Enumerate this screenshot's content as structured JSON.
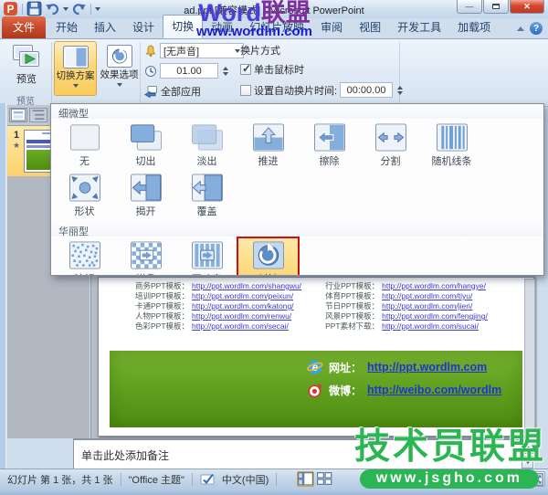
{
  "window": {
    "title": "ad.ppt [兼容模式] - Microsoft PowerPoint",
    "controls": [
      "minimize",
      "restore",
      "close"
    ]
  },
  "qat": {
    "icons": [
      "powerpoint-logo",
      "save",
      "undo",
      "redo",
      "customize-qat"
    ]
  },
  "tabs": [
    {
      "id": "file",
      "label": "文件",
      "file": true
    },
    {
      "id": "home",
      "label": "开始"
    },
    {
      "id": "insert",
      "label": "插入"
    },
    {
      "id": "design",
      "label": "设计"
    },
    {
      "id": "transitions",
      "label": "切换",
      "active": true
    },
    {
      "id": "animations",
      "label": "动画"
    },
    {
      "id": "slideshow",
      "label": "幻灯片放映"
    },
    {
      "id": "review",
      "label": "审阅"
    },
    {
      "id": "view",
      "label": "视图"
    },
    {
      "id": "developer",
      "label": "开发工具"
    },
    {
      "id": "addins",
      "label": "加载项"
    }
  ],
  "ribbon": {
    "preview_label": "预览",
    "preview_group_caption": "预览",
    "transition_scheme_label": "切换方案",
    "effect_options_label": "效果选项",
    "sound_value": "[无声音]",
    "duration_value": "01.00",
    "apply_all_label": "全部应用",
    "advance_title": "换片方式",
    "on_click_label": "单击鼠标时",
    "on_click_checked": true,
    "auto_advance_label": "设置自动换片时间:",
    "auto_advance_value": "00:00.00",
    "auto_advance_checked": false
  },
  "gallery": {
    "sections": [
      {
        "title": "细微型",
        "items": [
          {
            "label": "无",
            "icon": "none"
          },
          {
            "label": "切出",
            "icon": "cut"
          },
          {
            "label": "淡出",
            "icon": "fade"
          },
          {
            "label": "推进",
            "icon": "push"
          },
          {
            "label": "擦除",
            "icon": "wipe"
          },
          {
            "label": "分割",
            "icon": "split"
          },
          {
            "label": "随机线条",
            "icon": "random-bars"
          },
          {
            "label": "形状",
            "icon": "shape"
          },
          {
            "label": "揭开",
            "icon": "uncover"
          },
          {
            "label": "覆盖",
            "icon": "cover"
          }
        ]
      },
      {
        "title": "华丽型",
        "items": [
          {
            "label": "溶解",
            "icon": "dissolve"
          },
          {
            "label": "棋盘",
            "icon": "checkerboard"
          },
          {
            "label": "百叶窗",
            "icon": "blinds"
          },
          {
            "label": "时钟",
            "icon": "clock",
            "selected": true,
            "annotated": true
          }
        ]
      }
    ]
  },
  "slide_panel": {
    "slide_number": "1",
    "transition_star": "★"
  },
  "slide": {
    "links_left": [
      {
        "label": "商务PPT模板：",
        "url": "http://ppt.wordlm.com/shangwu/"
      },
      {
        "label": "培训PPT模板：",
        "url": "http://ppt.wordlm.com/peixun/"
      },
      {
        "label": "卡通PPT模板：",
        "url": "http://ppt.wordlm.com/katong/"
      },
      {
        "label": "人物PPT模板：",
        "url": "http://ppt.wordlm.com/renwu/"
      },
      {
        "label": "色彩PPT模板：",
        "url": "http://ppt.wordlm.com/secai/"
      }
    ],
    "links_right": [
      {
        "label": "行业PPT模板：",
        "url": "http://ppt.wordlm.com/hangye/"
      },
      {
        "label": "体育PPT模板：",
        "url": "http://ppt.wordlm.com/tiyu/"
      },
      {
        "label": "节日PPT模板：",
        "url": "http://ppt.wordlm.com/jieri/"
      },
      {
        "label": "风景PPT模板：",
        "url": "http://ppt.wordlm.com/fengjing/"
      },
      {
        "label": "PPT素材下载：",
        "url": "http://ppt.wordlm.com/sucai/"
      }
    ],
    "banner": {
      "site_label": "网址：",
      "site_url": "http://ppt.wordlm.com",
      "weibo_label": "微博：",
      "weibo_url": "http://weibo.com/wordlm"
    }
  },
  "notes": {
    "placeholder": "单击此处添加备注"
  },
  "status": {
    "slide_info": "幻灯片 第 1 张，共 1 张",
    "theme": "\"Office 主题\"",
    "language": "中文(中国)"
  },
  "watermarks": {
    "top": {
      "brand_en": "Word",
      "brand_cn": "联盟",
      "url": "www.wordlm.com"
    },
    "bottom": {
      "brand": "技术员联盟",
      "url": "www.jsgho.com"
    }
  },
  "colors": {
    "selection_orange": "#fbd26b",
    "annotation_red": "#cf1010",
    "file_tab_red": "#c44a2c",
    "slide_green": "#5a9e1e",
    "watermark_green": "#2cb553",
    "link_blue": "#3b3bd0"
  }
}
